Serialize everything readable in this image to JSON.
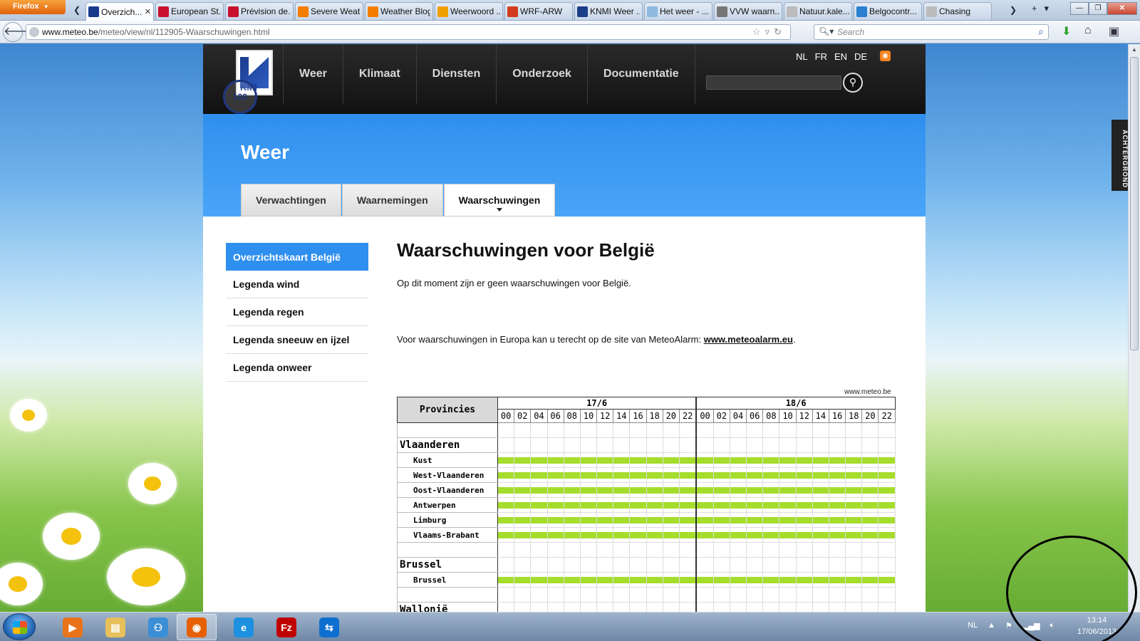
{
  "browser": {
    "menu_label": "Firefox",
    "tabs": [
      {
        "title": "Overzich...",
        "favicon": "kmi",
        "color": "#1a3a8e",
        "active": true
      },
      {
        "title": "European St...",
        "favicon": "k",
        "color": "#c8102e"
      },
      {
        "title": "Prévision de...",
        "favicon": "k",
        "color": "#c8102e"
      },
      {
        "title": "Severe Weat...",
        "favicon": "blogger",
        "color": "#f57d00"
      },
      {
        "title": "Weather Blog",
        "favicon": "blogger",
        "color": "#f57d00"
      },
      {
        "title": "Weerwoord ...",
        "favicon": "sun",
        "color": "#f0a000"
      },
      {
        "title": "WRF-ARW",
        "favicon": "wrf",
        "color": "#d23b1e"
      },
      {
        "title": "KNMI Weer ...",
        "favicon": "knmi",
        "color": "#1b3e8a"
      },
      {
        "title": "Het weer - ...",
        "favicon": "cloud",
        "color": "#8fb8e0"
      },
      {
        "title": "VVW waarn...",
        "favicon": "gear",
        "color": "#777777"
      },
      {
        "title": "Natuur.kale...",
        "favicon": "page",
        "color": "#bbbbbb"
      },
      {
        "title": "Belgocontr...",
        "favicon": "plane",
        "color": "#2a7fd0"
      },
      {
        "title": "Chasing",
        "favicon": "page",
        "color": "#bbbbbb"
      }
    ],
    "url_host": "www.meteo.be",
    "url_path": "/meteo/view/nl/112905-Waarschuwingen.html",
    "search_placeholder": "Search"
  },
  "site": {
    "logo_text": "KMI",
    "seal_text": "100",
    "nav": [
      "Weer",
      "Klimaat",
      "Diensten",
      "Onderzoek",
      "Documentatie"
    ],
    "languages": [
      "NL",
      "FR",
      "EN",
      "DE"
    ],
    "side_tab": "ACHTERGROND",
    "section_title": "Weer",
    "subtabs": [
      {
        "label": "Verwachtingen",
        "active": false
      },
      {
        "label": "Waarnemingen",
        "active": false
      },
      {
        "label": "Waarschuwingen",
        "active": true
      }
    ],
    "sidebar": [
      {
        "label": "Overzichtskaart België",
        "active": true
      },
      {
        "label": "Legenda wind",
        "active": false
      },
      {
        "label": "Legenda regen",
        "active": false
      },
      {
        "label": "Legenda sneeuw en ijzel",
        "active": false
      },
      {
        "label": "Legenda onweer",
        "active": false
      }
    ],
    "heading": "Waarschuwingen voor België",
    "intro": "Op dit moment zijn er geen waarschuwingen voor België.",
    "euro_prefix": "Voor  waarschuwingen in Europa kan u terecht op de site van MeteoAlarm: ",
    "euro_link": "www.meteoalarm.eu",
    "euro_suffix": "."
  },
  "warnings": {
    "credit": "www.meteo.be",
    "header_label": "Provincies",
    "dates": [
      "17/6",
      "18/6"
    ],
    "hours": [
      "00",
      "02",
      "04",
      "06",
      "08",
      "10",
      "12",
      "14",
      "16",
      "18",
      "20",
      "22"
    ],
    "warning_color": "#a5dd2c",
    "rows": [
      {
        "type": "blank"
      },
      {
        "type": "region",
        "label": "Vlaanderen"
      },
      {
        "type": "province",
        "label": "Kust",
        "level": "green"
      },
      {
        "type": "province",
        "label": "West-Vlaanderen",
        "level": "green"
      },
      {
        "type": "province",
        "label": "Oost-Vlaanderen",
        "level": "green"
      },
      {
        "type": "province",
        "label": "Antwerpen",
        "level": "green"
      },
      {
        "type": "province",
        "label": "Limburg",
        "level": "green"
      },
      {
        "type": "province",
        "label": "Vlaams-Brabant",
        "level": "green"
      },
      {
        "type": "blank"
      },
      {
        "type": "region",
        "label": "Brussel"
      },
      {
        "type": "province",
        "label": "Brussel",
        "level": "green"
      },
      {
        "type": "blank"
      },
      {
        "type": "region",
        "label": "Wallonië"
      }
    ]
  },
  "taskbar": {
    "apps": [
      {
        "name": "media-player",
        "glyph": "▶",
        "color": "#e8731a"
      },
      {
        "name": "explorer",
        "glyph": "▤",
        "color": "#e8c05a"
      },
      {
        "name": "network",
        "glyph": "⚇",
        "color": "#3b8fd6"
      },
      {
        "name": "firefox",
        "glyph": "◉",
        "color": "#e66000",
        "active": true
      },
      {
        "name": "internet-explorer",
        "glyph": "e",
        "color": "#1e90e0"
      },
      {
        "name": "filezilla",
        "glyph": "Fz",
        "color": "#bf0000"
      },
      {
        "name": "teamviewer",
        "glyph": "⇆",
        "color": "#0e6fd0"
      }
    ],
    "tray_lang": "NL",
    "clock_time": "13:14",
    "clock_date": "17/06/2013"
  }
}
